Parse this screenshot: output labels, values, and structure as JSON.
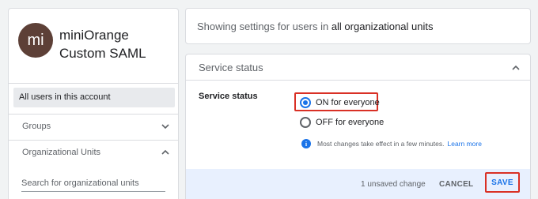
{
  "app": {
    "avatar_initials": "mi",
    "name": "miniOrange Custom SAML",
    "avatar_color": "#5d4037"
  },
  "sidebar": {
    "selected_ou": "All users in this account",
    "groups_label": "Groups",
    "ou_label": "Organizational Units",
    "search_placeholder": "Search for organizational units"
  },
  "scope": {
    "prefix": "Showing settings for users in ",
    "value": "all organizational units"
  },
  "service": {
    "card_title": "Service status",
    "setting_label": "Service status",
    "options": [
      {
        "label": "ON for everyone",
        "checked": true
      },
      {
        "label": "OFF for everyone",
        "checked": false
      }
    ],
    "info_text": "Most changes take effect in a few minutes.",
    "learn_more": "Learn more"
  },
  "footer": {
    "unsaved": "1 unsaved change",
    "cancel": "CANCEL",
    "save": "SAVE"
  },
  "colors": {
    "accent": "#1a73e8",
    "highlight": "#d93025"
  }
}
